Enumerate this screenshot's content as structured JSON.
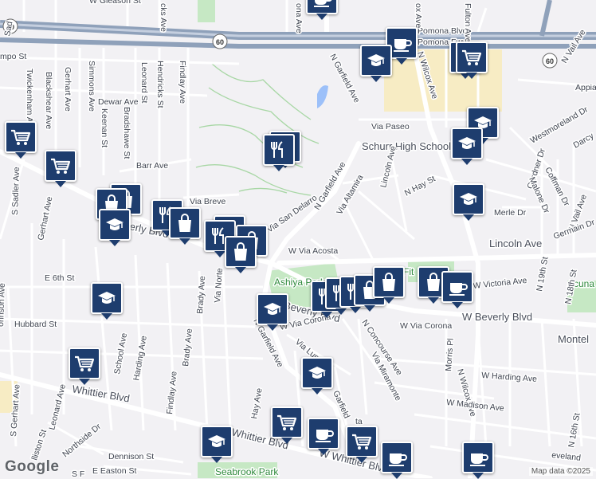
{
  "map": {
    "colors": {
      "background": "#f2f1f4",
      "road": "#ffffff",
      "freeway": "#8fa1ba",
      "park": "#c6e8c4",
      "water": "#9cc0f9",
      "campus": "#f7ecc4",
      "pin": "#1e3d6e"
    },
    "labels": [
      {
        "id": "w-gleason-st",
        "text": "W Gleason St"
      },
      {
        "id": "pomona-blvd",
        "text": "Pomona Blvd"
      },
      {
        "id": "pomona-fwy",
        "text": "Pomona Fwy"
      },
      {
        "id": "hwy-60-west",
        "text": "60"
      },
      {
        "id": "hwy-60-mid",
        "text": "60"
      },
      {
        "id": "hwy-60-east",
        "text": "60"
      },
      {
        "id": "ampo-st",
        "text": "mpo St"
      },
      {
        "id": "gerhart-ave-north",
        "text": "Gerhart Ave"
      },
      {
        "id": "twickenham-ave",
        "text": "Twickenham Ave"
      },
      {
        "id": "blackshear-ave",
        "text": "Blackshear Ave"
      },
      {
        "id": "simmons-ave",
        "text": "Simmons Ave"
      },
      {
        "id": "keenan-st",
        "text": "Keenan St"
      },
      {
        "id": "leonard-st",
        "text": "Leonard St"
      },
      {
        "id": "hendricks-st-north",
        "text": "Hendricks St"
      },
      {
        "id": "hendricks-st",
        "text": "Hendricks St"
      },
      {
        "id": "findlay-ave-north",
        "text": "Findlay Ave"
      },
      {
        "id": "bradshawe-st",
        "text": "Bradshawe St"
      },
      {
        "id": "dewar-ave",
        "text": "Dewar Ave"
      },
      {
        "id": "barr-ave",
        "text": "Barr Ave"
      },
      {
        "id": "via-breve",
        "text": "Via Breve"
      },
      {
        "id": "via-san-delarro",
        "text": "Via San Delarro"
      },
      {
        "id": "n-garfield-ave-north",
        "text": "N Garfield Ave"
      },
      {
        "id": "n-garfield-ave-mid",
        "text": "N Garfield Ave"
      },
      {
        "id": "n-wilcox-ave-north",
        "text": "N Wilcox Ave"
      },
      {
        "id": "fulton-ave",
        "text": "Fulton Ave"
      },
      {
        "id": "n-vail-ave",
        "text": "N Vail Ave"
      },
      {
        "id": "via-paseo",
        "text": "Via Paseo"
      },
      {
        "id": "schurr-high-school",
        "text": "Schurr High School"
      },
      {
        "id": "westmoreland-dr",
        "text": "Westmoreland Dr"
      },
      {
        "id": "darcy",
        "text": "Darcy"
      },
      {
        "id": "coffman-dr",
        "text": "Coffman Dr"
      },
      {
        "id": "gardner-dr",
        "text": "Gardner Dr"
      },
      {
        "id": "malone-dr",
        "text": "Malone Dr"
      },
      {
        "id": "lincoln-ave-vertical",
        "text": "Lincoln Ave"
      },
      {
        "id": "n-hay-st",
        "text": "N Hay St"
      },
      {
        "id": "via-altamira",
        "text": "Via Altamira"
      },
      {
        "id": "merle-dr",
        "text": "Merle Dr"
      },
      {
        "id": "n-vail-ave-east",
        "text": "N Vail Ave"
      },
      {
        "id": "germain-dr",
        "text": "Germain Dr"
      },
      {
        "id": "lincoln-ave",
        "text": "Lincoln Ave"
      },
      {
        "id": "appia",
        "text": "Appia"
      },
      {
        "id": "w-via-acosta",
        "text": "W Via Acosta"
      },
      {
        "id": "ashiya-park",
        "text": "Ashiya Park"
      },
      {
        "id": "fitness",
        "text": "Fit"
      },
      {
        "id": "w-victoria-ave",
        "text": "W Victoria Ave"
      },
      {
        "id": "acuna-park",
        "text": "Acuna P"
      },
      {
        "id": "n-19th-st",
        "text": "N 19th St"
      },
      {
        "id": "n-18th-st",
        "text": "N 18th St"
      },
      {
        "id": "w-beverly-blvd",
        "text": "W Beverly Blvd"
      },
      {
        "id": "beverly-blvd-west",
        "text": "erly Blvd"
      },
      {
        "id": "w-beverly-blvd-center",
        "text": "W Beverly Blvd"
      },
      {
        "id": "w-via-corona-east",
        "text": "W Via Corona"
      },
      {
        "id": "w-via-corona",
        "text": "W Via Corona"
      },
      {
        "id": "montebello",
        "text": "Montel"
      },
      {
        "id": "e-6th-st",
        "text": "E 6th St"
      },
      {
        "id": "hubbard-st",
        "text": "Hubbard St"
      },
      {
        "id": "s-sadler-ave",
        "text": "S Sadler Ave"
      },
      {
        "id": "gerhart-ave-mid",
        "text": "Gerhart Ave"
      },
      {
        "id": "s-gerhart-ave",
        "text": "S Gerhart Ave"
      },
      {
        "id": "ohnson-ave",
        "text": "ohnson Ave"
      },
      {
        "id": "school-ave",
        "text": "School Ave"
      },
      {
        "id": "harding-ave",
        "text": "Harding Ave"
      },
      {
        "id": "findlay-ave",
        "text": "Findlay Ave"
      },
      {
        "id": "brady-ave",
        "text": "Brady Ave"
      },
      {
        "id": "brady-ave-north",
        "text": "Brady Ave"
      },
      {
        "id": "via-norte",
        "text": "Via Norte"
      },
      {
        "id": "hay-ave",
        "text": "Hay Ave"
      },
      {
        "id": "n-garfield-ave-south",
        "text": "N Garfield Ave"
      },
      {
        "id": "via-lunera",
        "text": "Via Lunera"
      },
      {
        "id": "garfield-ave",
        "text": "Garfield"
      },
      {
        "id": "n-concourse-ave",
        "text": "N Concourse Ave"
      },
      {
        "id": "via-miramonte",
        "text": "Via Miramonte"
      },
      {
        "id": "n-wilcox-ave",
        "text": "N Wilcox Ave"
      },
      {
        "id": "morris-pl",
        "text": "Morris Pl"
      },
      {
        "id": "w-harding-ave",
        "text": "W Harding Ave"
      },
      {
        "id": "w-madison-ave",
        "text": "W Madison Ave"
      },
      {
        "id": "whittier-blvd-west",
        "text": "Whittier Blvd"
      },
      {
        "id": "whittier-blvd-mid",
        "text": "Whittier Blvd"
      },
      {
        "id": "whittier-blvd",
        "text": "Whittier Blvd"
      },
      {
        "id": "w-whittier-blvd",
        "text": "W Whittier Blvd"
      },
      {
        "id": "leonard-ave",
        "text": "Leonard Ave"
      },
      {
        "id": "northside-dr",
        "text": "Northside Dr"
      },
      {
        "id": "allston-st",
        "text": "lliston St"
      },
      {
        "id": "dennison-st",
        "text": "Dennison St"
      },
      {
        "id": "e-easton-st",
        "text": "E Easton St"
      },
      {
        "id": "s-ford",
        "text": "S F"
      },
      {
        "id": "seabrook-park",
        "text": "Seabrook Park"
      },
      {
        "id": "cleveland",
        "text": "eveland"
      },
      {
        "id": "n-16th-st",
        "text": "N 16th St"
      },
      {
        "id": "via-acosta-s",
        "text": "ta"
      },
      {
        "id": "w-victoria-s",
        "text": "ria"
      },
      {
        "id": "sad",
        "text": "Sad"
      },
      {
        "id": "ona-ave",
        "text": "ona Ave"
      },
      {
        "id": "ks-ave",
        "text": "cks Ave"
      },
      {
        "id": "vil-ave-top",
        "text": "ox Ave"
      },
      {
        "id": "fitn",
        "text": "Fitn"
      }
    ],
    "pins": [
      {
        "id": "coffee-1",
        "icon": "coffee"
      },
      {
        "id": "school-1",
        "icon": "school"
      },
      {
        "id": "shopping-cart-1",
        "icon": "shopping-cart"
      },
      {
        "id": "shopping-cart-2",
        "icon": "shopping-cart"
      },
      {
        "id": "school-2",
        "icon": "school"
      },
      {
        "id": "school-3",
        "icon": "school"
      },
      {
        "id": "shopping-cart-3",
        "icon": "shopping-cart"
      },
      {
        "id": "shopping-cart-4",
        "icon": "shopping-cart"
      },
      {
        "id": "restaurant-1",
        "icon": "restaurant"
      },
      {
        "id": "restaurant-2",
        "icon": "restaurant"
      },
      {
        "id": "school-4",
        "icon": "school"
      },
      {
        "id": "shopping-bag-1",
        "icon": "shopping-bag"
      },
      {
        "id": "shopping-bag-2",
        "icon": "shopping-bag"
      },
      {
        "id": "school-5",
        "icon": "school"
      },
      {
        "id": "restaurant-3",
        "icon": "restaurant"
      },
      {
        "id": "shopping-bag-3",
        "icon": "shopping-bag"
      },
      {
        "id": "restaurant-4",
        "icon": "restaurant"
      },
      {
        "id": "restaurant-5",
        "icon": "restaurant"
      },
      {
        "id": "shopping-bag-4",
        "icon": "shopping-bag"
      },
      {
        "id": "shopping-bag-5",
        "icon": "shopping-bag"
      },
      {
        "id": "school-6",
        "icon": "school"
      },
      {
        "id": "school-7",
        "icon": "school"
      },
      {
        "id": "restaurant-6",
        "icon": "restaurant"
      },
      {
        "id": "restaurant-7",
        "icon": "restaurant"
      },
      {
        "id": "restaurant-8",
        "icon": "restaurant"
      },
      {
        "id": "shopping-bag-6",
        "icon": "shopping-bag"
      },
      {
        "id": "shopping-bag-7",
        "icon": "shopping-bag"
      },
      {
        "id": "shopping-bag-8",
        "icon": "shopping-bag"
      },
      {
        "id": "coffee-2",
        "icon": "coffee"
      },
      {
        "id": "shopping-cart-5",
        "icon": "shopping-cart"
      },
      {
        "id": "school-8",
        "icon": "school"
      },
      {
        "id": "shopping-cart-6",
        "icon": "shopping-cart"
      },
      {
        "id": "coffee-3",
        "icon": "coffee"
      },
      {
        "id": "shopping-cart-7",
        "icon": "shopping-cart"
      },
      {
        "id": "school-9",
        "icon": "school"
      },
      {
        "id": "coffee-4",
        "icon": "coffee"
      },
      {
        "id": "coffee-5",
        "icon": "coffee"
      },
      {
        "id": "coffee-6",
        "icon": "coffee"
      }
    ],
    "attribution": "Map data ©2025",
    "logo": "Google"
  }
}
